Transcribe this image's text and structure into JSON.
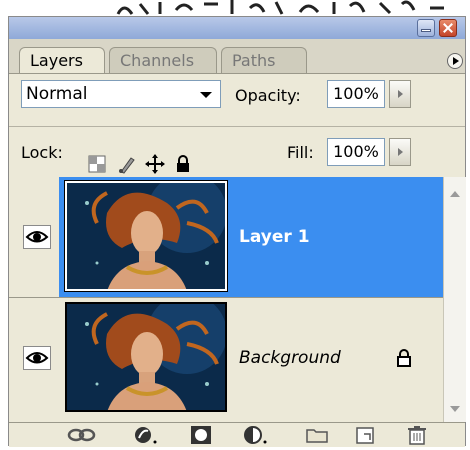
{
  "panel": {
    "tabs": [
      {
        "label": "Layers",
        "active": true
      },
      {
        "label": "Channels",
        "active": false
      },
      {
        "label": "Paths",
        "active": false
      }
    ],
    "blend_mode": "Normal",
    "opacity_label": "Opacity:",
    "opacity_value": "100%",
    "lock_label": "Lock:",
    "fill_label": "Fill:",
    "fill_value": "100%"
  },
  "layers": [
    {
      "name": "Layer 1",
      "selected": true,
      "visible": true,
      "locked": false
    },
    {
      "name": "Background",
      "selected": false,
      "visible": true,
      "locked": true
    }
  ],
  "bottom_icons": [
    "link-layers-icon",
    "layer-style-icon",
    "layer-mask-icon",
    "adjustment-layer-icon",
    "new-group-icon",
    "new-layer-icon",
    "delete-layer-icon"
  ],
  "colors": {
    "selection": "#3b8ef0",
    "panel_bg": "#ece9d8",
    "titlebar": "#8fa9d8"
  }
}
